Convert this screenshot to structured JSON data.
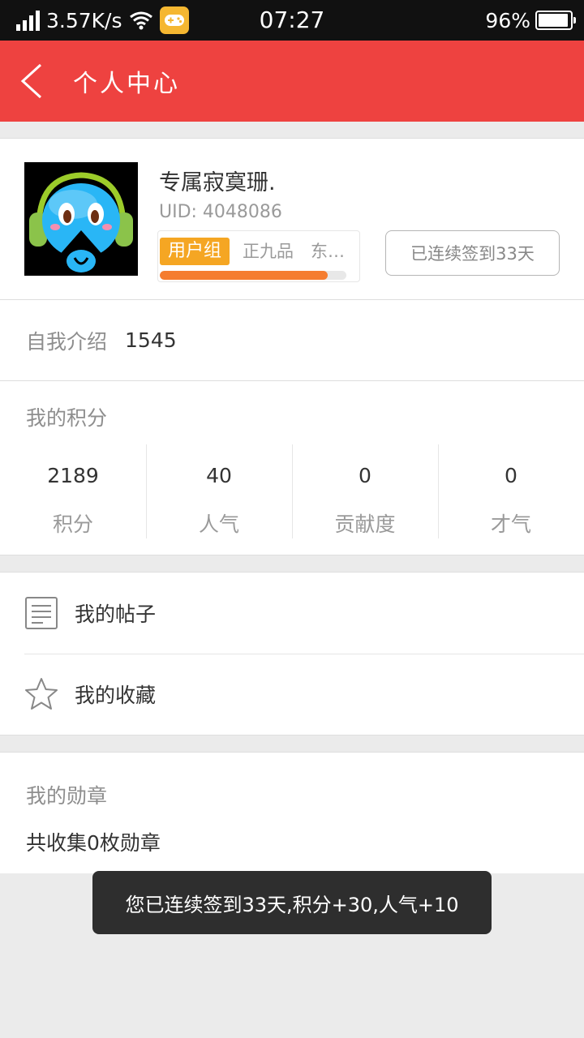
{
  "status_bar": {
    "net_speed": "3.57K/s",
    "time": "07:27",
    "battery": "96%",
    "battery_level": 0.96
  },
  "header": {
    "title": "个人中心"
  },
  "profile": {
    "name": "专属寂寞珊.",
    "uid": "UID: 4048086",
    "group_tag": "用户组",
    "group_level": "正九品　东…",
    "progress": 0.9,
    "checkin_label": "已连续签到33天",
    "colors": {
      "tag": "#f5a623",
      "progress": "#f57c2f"
    }
  },
  "intro": {
    "label": "自我介绍",
    "value": "1545"
  },
  "points": {
    "title": "我的积分",
    "stats": [
      {
        "value": "2189",
        "label": "积分"
      },
      {
        "value": "40",
        "label": "人气"
      },
      {
        "value": "0",
        "label": "贡献度"
      },
      {
        "value": "0",
        "label": "才气"
      }
    ]
  },
  "menu": {
    "items": [
      {
        "label": "我的帖子",
        "icon": "document-icon"
      },
      {
        "label": "我的收藏",
        "icon": "star-icon"
      }
    ]
  },
  "medals": {
    "title": "我的勋章",
    "count_text": "共收集0枚勋章"
  },
  "toast": {
    "text": "您已连续签到33天,积分+30,人气+10"
  },
  "theme": {
    "accent": "#ee4240"
  }
}
